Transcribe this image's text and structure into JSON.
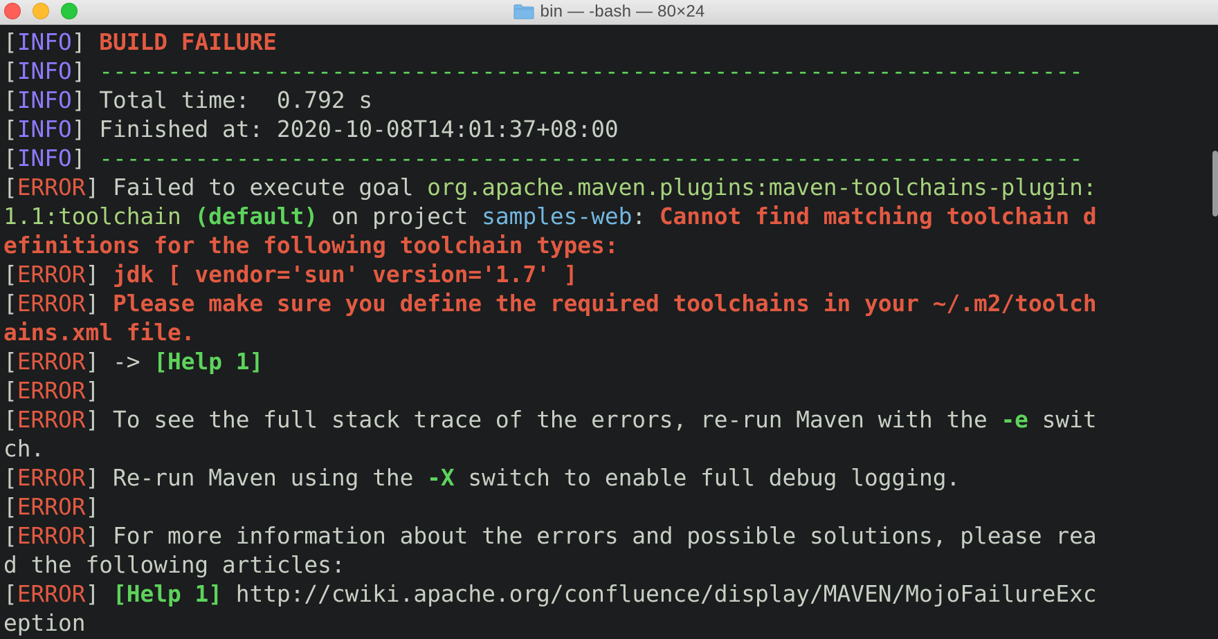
{
  "window": {
    "title": "bin — -bash — 80×24",
    "folder_icon": "folder-icon",
    "colors": {
      "background": "#1b1d1e",
      "info_tag": "#8c7bff",
      "error_tag": "#e35a42",
      "error_text": "#e35a42",
      "highlight_green": "#5ed35c",
      "plugin_green": "#a6d37c",
      "project_blue": "#74b7e0",
      "default_text": "#c8cfc4"
    }
  },
  "terminal": {
    "lines": [
      {
        "b1": "[",
        "tag": "INFO",
        "b2": "] ",
        "s1": "BUILD FAILURE"
      },
      {
        "b1": "[",
        "tag": "INFO",
        "b2": "] ",
        "s1": "------------------------------------------------------------------------"
      },
      {
        "b1": "[",
        "tag": "INFO",
        "b2": "] ",
        "s1": "Total time:  0.792 s"
      },
      {
        "b1": "[",
        "tag": "INFO",
        "b2": "] ",
        "s1": "Finished at: 2020-10-08T14:01:37+08:00"
      },
      {
        "b1": "[",
        "tag": "INFO",
        "b2": "] ",
        "s1": "------------------------------------------------------------------------"
      },
      {
        "b1": "[",
        "tag": "ERROR",
        "b2": "] ",
        "s1": "Failed to execute goal ",
        "s2": "org.apache.maven.plugins:maven-toolchains-plugin:"
      },
      {
        "s1": "1.1:toolchain ",
        "s2": "(default)",
        "s3": " on project ",
        "s4": "samples-web",
        "s5": ": ",
        "s6": "Cannot find matching toolchain d"
      },
      {
        "s1": "efinitions for the following toolchain types:"
      },
      {
        "b1": "[",
        "tag": "ERROR",
        "b2": "] ",
        "s1": "jdk [ vendor='sun' version='1.7' ]"
      },
      {
        "b1": "[",
        "tag": "ERROR",
        "b2": "] ",
        "s1": "Please make sure you define the required toolchains in your ~/.m2/toolch"
      },
      {
        "s1": "ains.xml file."
      },
      {
        "b1": "[",
        "tag": "ERROR",
        "b2": "] ",
        "s1": "-> ",
        "s2": "[Help 1]"
      },
      {
        "b1": "[",
        "tag": "ERROR",
        "b2": "]"
      },
      {
        "b1": "[",
        "tag": "ERROR",
        "b2": "] ",
        "s1": "To see the full stack trace of the errors, re-run Maven with the ",
        "s2": "-e",
        "s3": " swit"
      },
      {
        "s1": "ch."
      },
      {
        "b1": "[",
        "tag": "ERROR",
        "b2": "] ",
        "s1": "Re-run Maven using the ",
        "s2": "-X",
        "s3": " switch to enable full debug logging."
      },
      {
        "b1": "[",
        "tag": "ERROR",
        "b2": "]"
      },
      {
        "b1": "[",
        "tag": "ERROR",
        "b2": "] ",
        "s1": "For more information about the errors and possible solutions, please rea"
      },
      {
        "s1": "d the following articles:"
      },
      {
        "b1": "[",
        "tag": "ERROR",
        "b2": "] ",
        "s1": "[Help 1]",
        "s2": " http://cwiki.apache.org/confluence/display/MAVEN/MojoFailureExc"
      },
      {
        "s1": "eption"
      }
    ]
  }
}
